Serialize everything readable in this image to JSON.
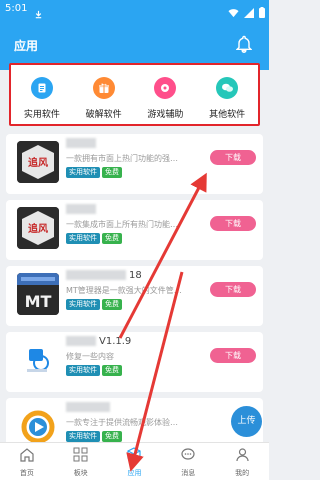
{
  "status_bar": {
    "time": "5:01"
  },
  "app_bar": {
    "title": "应用"
  },
  "categories": [
    {
      "label": "实用软件",
      "icon": "doc-icon",
      "color": "#2ba5f2"
    },
    {
      "label": "破解软件",
      "icon": "gift-icon",
      "color": "#ff8a34"
    },
    {
      "label": "游戏辅助",
      "icon": "game-icon",
      "color": "#ff4f8b"
    },
    {
      "label": "其他软件",
      "icon": "chat-icon",
      "color": "#25c7b9"
    }
  ],
  "apps": [
    {
      "name_suffix": "",
      "desc_start": "一款拥有市面上热门功能的强…",
      "desc_end": "",
      "tags": [
        "实用软件",
        "免费"
      ],
      "download": "下载",
      "thumb_text": "追风"
    },
    {
      "name_suffix": "",
      "desc_start": "一款集成市面上所有热门功能…",
      "desc_end": "",
      "tags": [
        "实用软件",
        "免费"
      ],
      "download": "下载",
      "thumb_text": "追风"
    },
    {
      "name_suffix": "18",
      "desc_start": "MT管理器是一款强大的文件管…",
      "desc_end": "",
      "tags": [
        "实用软件",
        "免费"
      ],
      "download": "下载",
      "thumb_text": "MT"
    },
    {
      "name_suffix": "V1.1.9",
      "desc_start": "修复一些内容",
      "desc_end": "",
      "tags": [
        "实用软件",
        "免费"
      ],
      "download": "下载",
      "thumb_text": ""
    },
    {
      "name_suffix": "",
      "desc_start": "一款专注于提供流畅观影体验…",
      "desc_end": "",
      "tags": [
        "实用软件",
        "免费"
      ],
      "download": "下载",
      "thumb_text": ""
    }
  ],
  "upload_button": "上传",
  "bottom_nav": [
    {
      "label": "首页",
      "icon": "home-icon"
    },
    {
      "label": "板块",
      "icon": "grid-icon"
    },
    {
      "label": "应用",
      "icon": "box-icon",
      "active": true
    },
    {
      "label": "消息",
      "icon": "message-icon"
    },
    {
      "label": "我的",
      "icon": "user-icon"
    }
  ],
  "colors": {
    "primary": "#2ba5f2",
    "download": "#f06292",
    "highlight": "#e2252b"
  }
}
